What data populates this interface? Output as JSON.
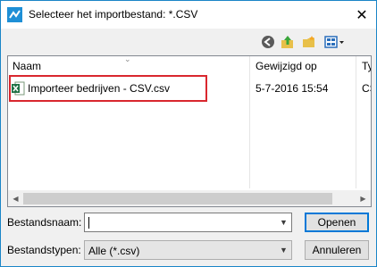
{
  "window": {
    "title": "Selecteer het importbestand: *.CSV",
    "close_glyph": "✕"
  },
  "toolbar": {
    "icons": [
      "back-icon",
      "up-folder-icon",
      "new-folder-icon",
      "view-menu-icon"
    ]
  },
  "columns": {
    "name": "Naam",
    "modified": "Gewijzigd op",
    "type": "Ty"
  },
  "files": [
    {
      "name": "Importeer bedrijven - CSV.csv",
      "modified": "5-7-2016 15:54",
      "type": "CS",
      "icon": "excel-csv-icon"
    }
  ],
  "form": {
    "filename_label": "Bestandsnaam:",
    "filename_value": "",
    "filetype_label": "Bestandstypen:",
    "filetype_value": "Alle (*.csv)"
  },
  "buttons": {
    "open": "Openen",
    "cancel": "Annuleren"
  },
  "colors": {
    "highlight": "#d9272e",
    "accent": "#0078d7"
  }
}
